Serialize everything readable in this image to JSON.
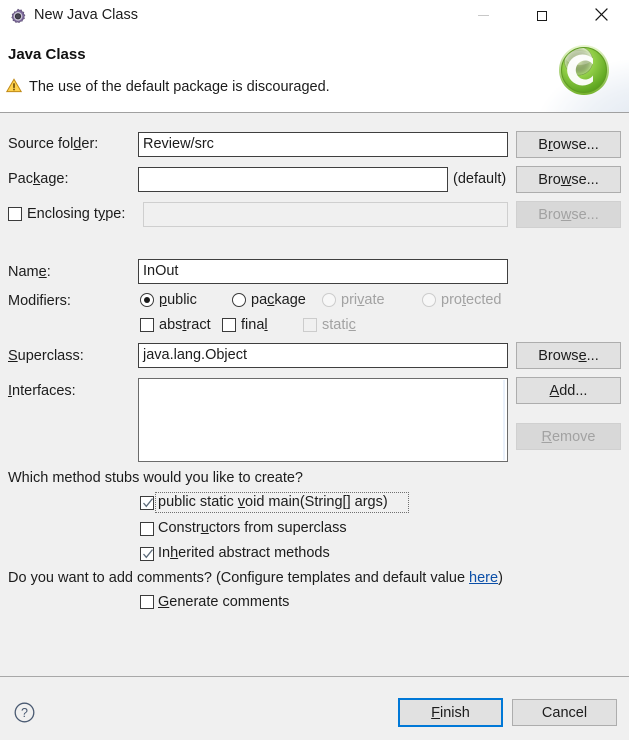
{
  "window": {
    "title": "New Java Class",
    "icon": "gear-icon",
    "controls": {
      "minimize": "minimize-icon",
      "maximize": "maximize-icon",
      "close": "close-icon"
    }
  },
  "header": {
    "title": "Java Class",
    "warning_icon": "warning-triangle-icon",
    "warning_text": "The use of the default package is discouraged.",
    "logo": "java-class-c-badge-icon"
  },
  "form": {
    "source_folder": {
      "label_pre": "Source fol",
      "label_mnemonic": "d",
      "label_post": "er:",
      "value": "Review/src",
      "browse": {
        "pre": "B",
        "mnemonic": "r",
        "post": "owse..."
      }
    },
    "package": {
      "label_pre": "Pac",
      "label_mnemonic": "k",
      "label_post": "age:",
      "value": "",
      "suffix": "(default)",
      "browse": {
        "pre": "Bro",
        "mnemonic": "w",
        "post": "se..."
      }
    },
    "enclosing_type": {
      "checked": false,
      "label_pre": "Enclosing t",
      "label_mnemonic": "y",
      "label_post": "pe:",
      "value": "",
      "browse": {
        "pre": "Bro",
        "mnemonic": "w",
        "post": "se..."
      }
    },
    "name": {
      "label_pre": "Nam",
      "label_mnemonic": "e",
      "label_post": ":",
      "value": "InOut"
    },
    "modifiers": {
      "label": "Modifiers:",
      "radios": [
        {
          "pre": "",
          "mnemonic": "p",
          "post": "ublic",
          "selected": true,
          "enabled": true
        },
        {
          "pre": "pa",
          "mnemonic": "c",
          "post": "kage",
          "selected": false,
          "enabled": true
        },
        {
          "pre": "pri",
          "mnemonic": "v",
          "post": "ate",
          "selected": false,
          "enabled": false
        },
        {
          "pre": "pro",
          "mnemonic": "t",
          "post": "ected",
          "selected": false,
          "enabled": false
        }
      ],
      "checkboxes": [
        {
          "pre": "abs",
          "mnemonic": "t",
          "post": "ract",
          "checked": false,
          "enabled": true
        },
        {
          "pre": "fina",
          "mnemonic": "l",
          "post": "",
          "checked": false,
          "enabled": true
        },
        {
          "pre": "stati",
          "mnemonic": "c",
          "post": "",
          "checked": false,
          "enabled": false
        }
      ]
    },
    "superclass": {
      "label_pre": "",
      "label_mnemonic": "S",
      "label_post": "uperclass:",
      "value": "java.lang.Object",
      "browse": {
        "pre": "Brows",
        "mnemonic": "e",
        "post": "..."
      }
    },
    "interfaces": {
      "label_pre": "",
      "label_mnemonic": "I",
      "label_post": "nterfaces:",
      "items": [],
      "add": {
        "pre": "",
        "mnemonic": "A",
        "post": "dd..."
      },
      "remove": {
        "pre": "",
        "mnemonic": "R",
        "post": "emove",
        "enabled": false
      }
    }
  },
  "stubs": {
    "question": "Which method stubs would you like to create?",
    "options": [
      {
        "pre": "public static ",
        "mnemonic": "v",
        "post": "oid main(String[] args)",
        "checked": true,
        "focused": true
      },
      {
        "pre": "Constr",
        "mnemonic": "u",
        "post": "ctors from superclass",
        "checked": false,
        "focused": false
      },
      {
        "pre": "In",
        "mnemonic": "h",
        "post": "erited abstract methods",
        "checked": true,
        "focused": false
      }
    ]
  },
  "comments": {
    "question_pre": "Do you want to add comments? (Configure templates and default value ",
    "link": "here",
    "question_post": ")",
    "generate": {
      "pre": "",
      "mnemonic": "G",
      "post": "enerate comments",
      "checked": false
    }
  },
  "footer": {
    "help_icon": "help-question-icon",
    "finish": {
      "pre": "",
      "mnemonic": "F",
      "post": "inish"
    },
    "cancel": "Cancel"
  },
  "colors": {
    "dialog_bg": "#f0f0f0",
    "header_bg": "#ffffff",
    "accent_blue": "#0078d7",
    "link_blue": "#0b4fa8",
    "warning_amber": "#f2b01e",
    "logo_green": "#7ac943"
  }
}
